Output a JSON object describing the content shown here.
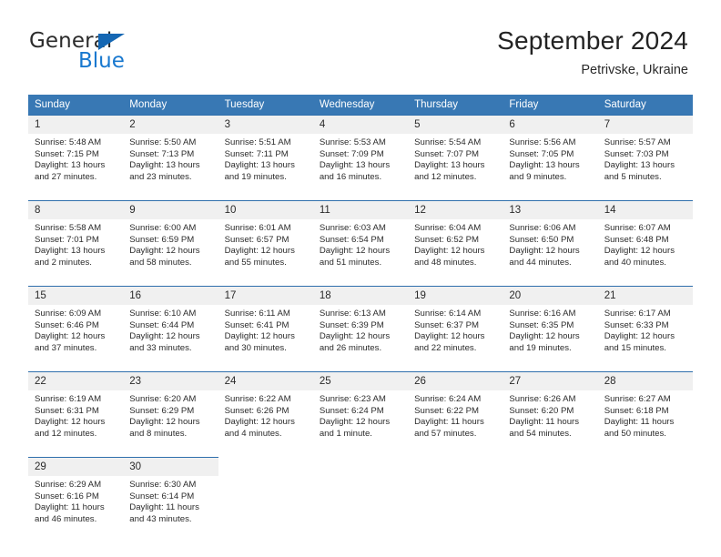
{
  "brand": {
    "line1": "General",
    "line2": "Blue",
    "flag_color": "#1567b3"
  },
  "header": {
    "title": "September 2024",
    "location": "Petrivske, Ukraine"
  },
  "theme": {
    "header_bg": "#3878b4",
    "cell_border": "#2f6fac",
    "daynum_bg": "#f0f0f0"
  },
  "weekday_headers": [
    "Sunday",
    "Monday",
    "Tuesday",
    "Wednesday",
    "Thursday",
    "Friday",
    "Saturday"
  ],
  "labels": {
    "sunrise_prefix": "Sunrise:",
    "sunset_prefix": "Sunset:",
    "daylight_prefix": "Daylight:"
  },
  "weeks": [
    [
      {
        "day": "1",
        "sunrise": "Sunrise: 5:48 AM",
        "sunset": "Sunset: 7:15 PM",
        "daylight1": "Daylight: 13 hours",
        "daylight2": "and 27 minutes."
      },
      {
        "day": "2",
        "sunrise": "Sunrise: 5:50 AM",
        "sunset": "Sunset: 7:13 PM",
        "daylight1": "Daylight: 13 hours",
        "daylight2": "and 23 minutes."
      },
      {
        "day": "3",
        "sunrise": "Sunrise: 5:51 AM",
        "sunset": "Sunset: 7:11 PM",
        "daylight1": "Daylight: 13 hours",
        "daylight2": "and 19 minutes."
      },
      {
        "day": "4",
        "sunrise": "Sunrise: 5:53 AM",
        "sunset": "Sunset: 7:09 PM",
        "daylight1": "Daylight: 13 hours",
        "daylight2": "and 16 minutes."
      },
      {
        "day": "5",
        "sunrise": "Sunrise: 5:54 AM",
        "sunset": "Sunset: 7:07 PM",
        "daylight1": "Daylight: 13 hours",
        "daylight2": "and 12 minutes."
      },
      {
        "day": "6",
        "sunrise": "Sunrise: 5:56 AM",
        "sunset": "Sunset: 7:05 PM",
        "daylight1": "Daylight: 13 hours",
        "daylight2": "and 9 minutes."
      },
      {
        "day": "7",
        "sunrise": "Sunrise: 5:57 AM",
        "sunset": "Sunset: 7:03 PM",
        "daylight1": "Daylight: 13 hours",
        "daylight2": "and 5 minutes."
      }
    ],
    [
      {
        "day": "8",
        "sunrise": "Sunrise: 5:58 AM",
        "sunset": "Sunset: 7:01 PM",
        "daylight1": "Daylight: 13 hours",
        "daylight2": "and 2 minutes."
      },
      {
        "day": "9",
        "sunrise": "Sunrise: 6:00 AM",
        "sunset": "Sunset: 6:59 PM",
        "daylight1": "Daylight: 12 hours",
        "daylight2": "and 58 minutes."
      },
      {
        "day": "10",
        "sunrise": "Sunrise: 6:01 AM",
        "sunset": "Sunset: 6:57 PM",
        "daylight1": "Daylight: 12 hours",
        "daylight2": "and 55 minutes."
      },
      {
        "day": "11",
        "sunrise": "Sunrise: 6:03 AM",
        "sunset": "Sunset: 6:54 PM",
        "daylight1": "Daylight: 12 hours",
        "daylight2": "and 51 minutes."
      },
      {
        "day": "12",
        "sunrise": "Sunrise: 6:04 AM",
        "sunset": "Sunset: 6:52 PM",
        "daylight1": "Daylight: 12 hours",
        "daylight2": "and 48 minutes."
      },
      {
        "day": "13",
        "sunrise": "Sunrise: 6:06 AM",
        "sunset": "Sunset: 6:50 PM",
        "daylight1": "Daylight: 12 hours",
        "daylight2": "and 44 minutes."
      },
      {
        "day": "14",
        "sunrise": "Sunrise: 6:07 AM",
        "sunset": "Sunset: 6:48 PM",
        "daylight1": "Daylight: 12 hours",
        "daylight2": "and 40 minutes."
      }
    ],
    [
      {
        "day": "15",
        "sunrise": "Sunrise: 6:09 AM",
        "sunset": "Sunset: 6:46 PM",
        "daylight1": "Daylight: 12 hours",
        "daylight2": "and 37 minutes."
      },
      {
        "day": "16",
        "sunrise": "Sunrise: 6:10 AM",
        "sunset": "Sunset: 6:44 PM",
        "daylight1": "Daylight: 12 hours",
        "daylight2": "and 33 minutes."
      },
      {
        "day": "17",
        "sunrise": "Sunrise: 6:11 AM",
        "sunset": "Sunset: 6:41 PM",
        "daylight1": "Daylight: 12 hours",
        "daylight2": "and 30 minutes."
      },
      {
        "day": "18",
        "sunrise": "Sunrise: 6:13 AM",
        "sunset": "Sunset: 6:39 PM",
        "daylight1": "Daylight: 12 hours",
        "daylight2": "and 26 minutes."
      },
      {
        "day": "19",
        "sunrise": "Sunrise: 6:14 AM",
        "sunset": "Sunset: 6:37 PM",
        "daylight1": "Daylight: 12 hours",
        "daylight2": "and 22 minutes."
      },
      {
        "day": "20",
        "sunrise": "Sunrise: 6:16 AM",
        "sunset": "Sunset: 6:35 PM",
        "daylight1": "Daylight: 12 hours",
        "daylight2": "and 19 minutes."
      },
      {
        "day": "21",
        "sunrise": "Sunrise: 6:17 AM",
        "sunset": "Sunset: 6:33 PM",
        "daylight1": "Daylight: 12 hours",
        "daylight2": "and 15 minutes."
      }
    ],
    [
      {
        "day": "22",
        "sunrise": "Sunrise: 6:19 AM",
        "sunset": "Sunset: 6:31 PM",
        "daylight1": "Daylight: 12 hours",
        "daylight2": "and 12 minutes."
      },
      {
        "day": "23",
        "sunrise": "Sunrise: 6:20 AM",
        "sunset": "Sunset: 6:29 PM",
        "daylight1": "Daylight: 12 hours",
        "daylight2": "and 8 minutes."
      },
      {
        "day": "24",
        "sunrise": "Sunrise: 6:22 AM",
        "sunset": "Sunset: 6:26 PM",
        "daylight1": "Daylight: 12 hours",
        "daylight2": "and 4 minutes."
      },
      {
        "day": "25",
        "sunrise": "Sunrise: 6:23 AM",
        "sunset": "Sunset: 6:24 PM",
        "daylight1": "Daylight: 12 hours",
        "daylight2": "and 1 minute."
      },
      {
        "day": "26",
        "sunrise": "Sunrise: 6:24 AM",
        "sunset": "Sunset: 6:22 PM",
        "daylight1": "Daylight: 11 hours",
        "daylight2": "and 57 minutes."
      },
      {
        "day": "27",
        "sunrise": "Sunrise: 6:26 AM",
        "sunset": "Sunset: 6:20 PM",
        "daylight1": "Daylight: 11 hours",
        "daylight2": "and 54 minutes."
      },
      {
        "day": "28",
        "sunrise": "Sunrise: 6:27 AM",
        "sunset": "Sunset: 6:18 PM",
        "daylight1": "Daylight: 11 hours",
        "daylight2": "and 50 minutes."
      }
    ],
    [
      {
        "day": "29",
        "sunrise": "Sunrise: 6:29 AM",
        "sunset": "Sunset: 6:16 PM",
        "daylight1": "Daylight: 11 hours",
        "daylight2": "and 46 minutes."
      },
      {
        "day": "30",
        "sunrise": "Sunrise: 6:30 AM",
        "sunset": "Sunset: 6:14 PM",
        "daylight1": "Daylight: 11 hours",
        "daylight2": "and 43 minutes."
      },
      {
        "day": "",
        "sunrise": "",
        "sunset": "",
        "daylight1": "",
        "daylight2": ""
      },
      {
        "day": "",
        "sunrise": "",
        "sunset": "",
        "daylight1": "",
        "daylight2": ""
      },
      {
        "day": "",
        "sunrise": "",
        "sunset": "",
        "daylight1": "",
        "daylight2": ""
      },
      {
        "day": "",
        "sunrise": "",
        "sunset": "",
        "daylight1": "",
        "daylight2": ""
      },
      {
        "day": "",
        "sunrise": "",
        "sunset": "",
        "daylight1": "",
        "daylight2": ""
      }
    ]
  ]
}
